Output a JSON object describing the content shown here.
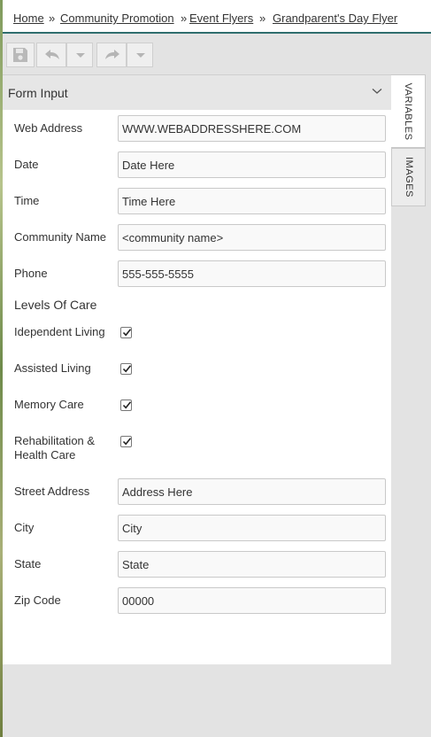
{
  "breadcrumb": {
    "items": [
      "Home",
      "Community Promotion",
      "Event Flyers",
      "Grandparent's Day Flyer"
    ],
    "separator": "»"
  },
  "toolbar": {
    "buttons": [
      {
        "name": "save",
        "icon": "floppy-disk-icon",
        "enabled": false
      },
      {
        "name": "undo",
        "icon": "undo-arrow-icon",
        "enabled": false
      },
      {
        "name": "undo-menu",
        "icon": "chevron-down-icon",
        "enabled": false
      },
      {
        "name": "redo",
        "icon": "redo-arrow-icon",
        "enabled": false
      },
      {
        "name": "redo-menu",
        "icon": "chevron-down-icon",
        "enabled": false
      }
    ]
  },
  "panel": {
    "title": "Form Input",
    "collapse_icon": "chevron-down-icon"
  },
  "fields": {
    "web_address": {
      "label": "Web Address",
      "value": "WWW.WEBADDRESSHERE.COM"
    },
    "date": {
      "label": "Date",
      "value": "Date Here"
    },
    "time": {
      "label": "Time",
      "value": "Time Here"
    },
    "community_name": {
      "label": "Community Name",
      "value": "<community name>"
    },
    "phone": {
      "label": "Phone",
      "value": "555-555-5555"
    },
    "street_address": {
      "label": "Street Address",
      "value": "Address Here"
    },
    "city": {
      "label": "City",
      "value": "City"
    },
    "state": {
      "label": "State",
      "value": "State"
    },
    "zip_code": {
      "label": "Zip Code",
      "value": "00000"
    }
  },
  "levels_of_care": {
    "heading": "Levels Of Care",
    "items": [
      {
        "label": "Idependent Living",
        "checked": true
      },
      {
        "label": "Assisted Living",
        "checked": true
      },
      {
        "label": "Memory Care",
        "checked": true
      },
      {
        "label": "Rehabilitation & Health Care",
        "checked": true
      }
    ]
  },
  "side_tabs": [
    {
      "label": "VARIABLES",
      "active": true
    },
    {
      "label": "IMAGES",
      "active": false
    }
  ],
  "colors": {
    "accent_rule": "#2f6e6e",
    "panel_bg": "#ffffff",
    "page_bg": "#e3e3e3"
  }
}
